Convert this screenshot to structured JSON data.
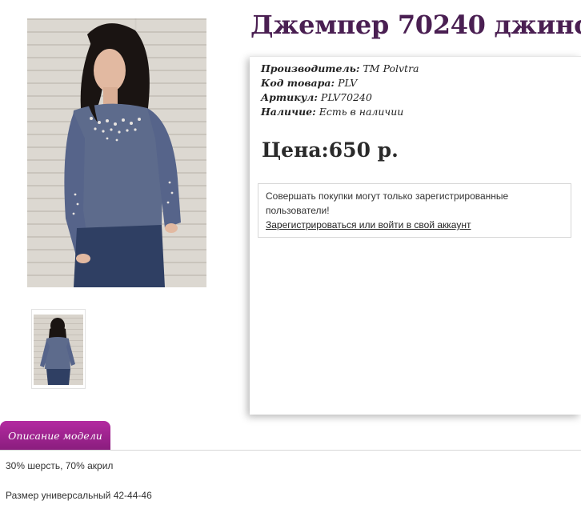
{
  "product": {
    "title": "Джемпер 70240 джинс",
    "main_image_alt": "model-wearing-denim-jumper",
    "thumb_image_alt": "model-back-view",
    "specs": [
      {
        "label": "Производитель:",
        "value": "ТМ Polvtra"
      },
      {
        "label": "Код товара:",
        "value": "PLV"
      },
      {
        "label": "Артикул:",
        "value": "PLV70240"
      },
      {
        "label": "Наличие:",
        "value": "Есть в наличии"
      }
    ],
    "price": "Цена:650 р."
  },
  "notice": {
    "text": "Совершать покупки могут только зарегистрированные пользователи!",
    "link": "Зарегистрироваться или войти в свой аккаунт"
  },
  "tabs": [
    {
      "label": "Описание модели",
      "active": true
    }
  ],
  "description": {
    "lines": [
      "30% шерсть, 70% акрил",
      "Размер универсальный 42-44-46"
    ]
  },
  "colors": {
    "title": "#4a1f52",
    "tab": "#a0248f",
    "sweater": "#5d6b8c"
  }
}
